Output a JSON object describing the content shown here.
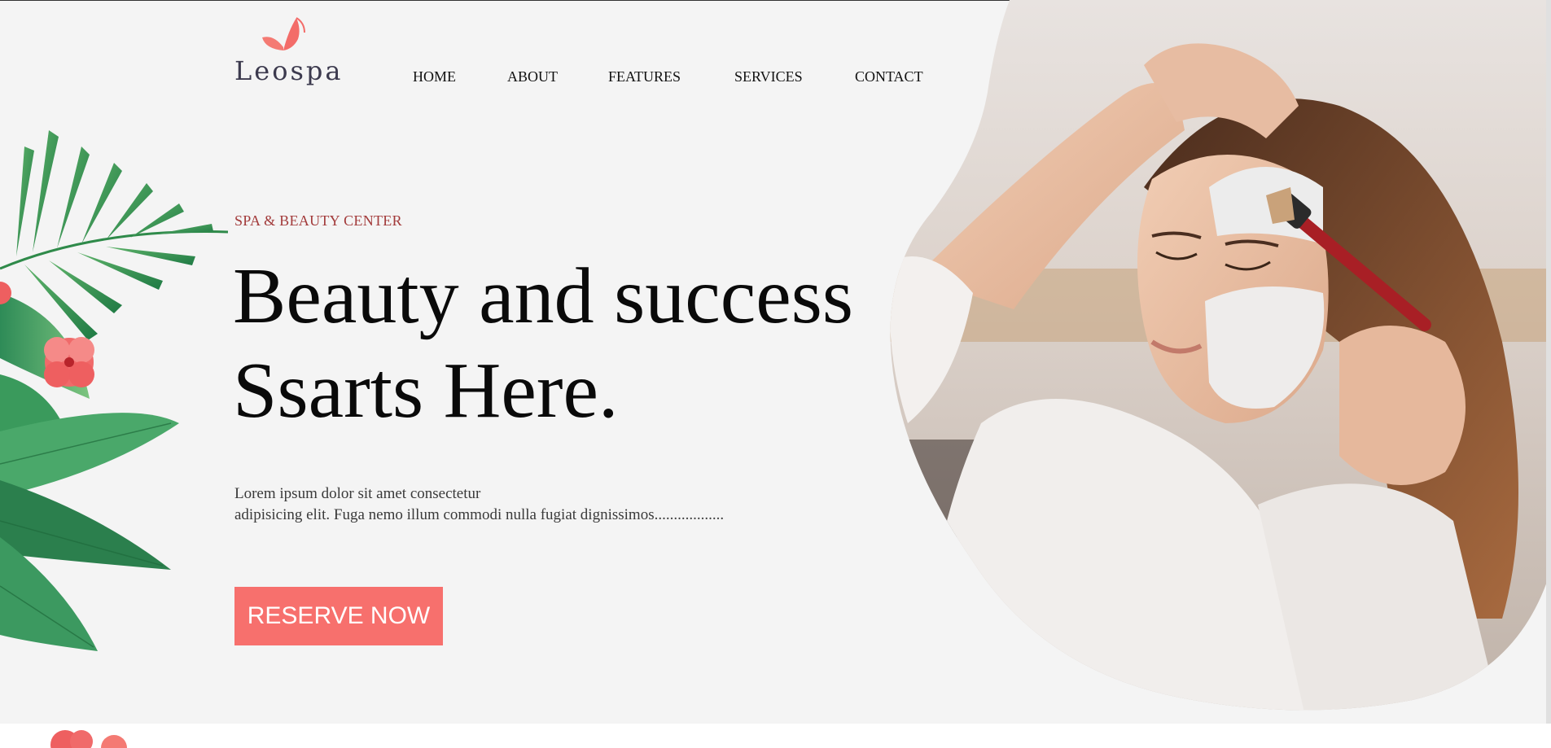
{
  "brand": {
    "name": "Leospa",
    "accent_color": "#f7706d",
    "eyebrow_color": "#a23a3a"
  },
  "nav": {
    "items": [
      {
        "label": "HOME"
      },
      {
        "label": "ABOUT"
      },
      {
        "label": "FEATURES"
      },
      {
        "label": "SERVICES"
      },
      {
        "label": "CONTACT"
      }
    ]
  },
  "hero": {
    "eyebrow": "SPA & BEAUTY CENTER",
    "headline_line1": "Beauty and success",
    "headline_line2": "Ssarts Here.",
    "body_line1": "Lorem ipsum dolor sit amet consectetur",
    "body_line2": "adipisicing elit. Fuga nemo illum commodi nulla fugiat dignissimos..................",
    "cta_label": "RESERVE NOW",
    "image_icon": "woman-facial-mask-photo"
  },
  "decorations": {
    "left_foliage_icon": "tropical-leaves-illustration",
    "logo_icon": "butterfly-icon",
    "bottom_icon": "hibiscus-flower-icon"
  }
}
